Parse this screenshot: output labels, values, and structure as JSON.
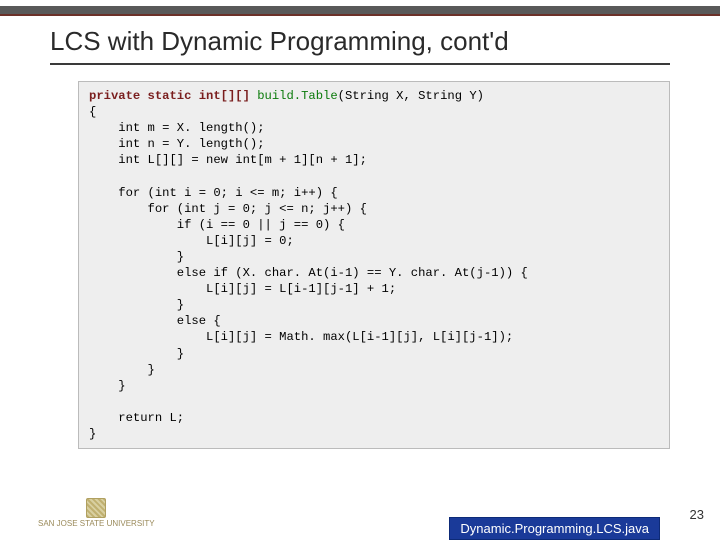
{
  "slide": {
    "title": "LCS with Dynamic Programming, cont'd",
    "page_number": "23",
    "file_badge": "Dynamic.Programming.LCS.java",
    "logo_text": "SAN JOSE STATE\nUNIVERSITY"
  },
  "code": {
    "sig_prefix": "private static int[][] ",
    "sig_fn": "build.Table",
    "sig_suffix": "(String X, String Y)",
    "l_open": "{",
    "l_m": "    int m = X. length();",
    "l_n": "    int n = Y. length();",
    "l_L": "    int L[][] = new int[m + 1][n + 1];",
    "l_blank1": "",
    "l_for_i": "    for (int i = 0; i <= m; i++) {",
    "l_for_j": "        for (int j = 0; j <= n; j++) {",
    "l_if": "            if (i == 0 || j == 0) {",
    "l_zero": "                L[i][j] = 0;",
    "l_close1": "            }",
    "l_elseif": "            else if (X. char. At(i-1) == Y. char. At(j-1)) {",
    "l_diag": "                L[i][j] = L[i-1][j-1] + 1;",
    "l_close2": "            }",
    "l_else": "            else {",
    "l_max": "                L[i][j] = Math. max(L[i-1][j], L[i][j-1]);",
    "l_close3": "            }",
    "l_close_j": "        }",
    "l_close_i": "    }",
    "l_blank2": "",
    "l_return": "    return L;",
    "l_close": "}"
  }
}
